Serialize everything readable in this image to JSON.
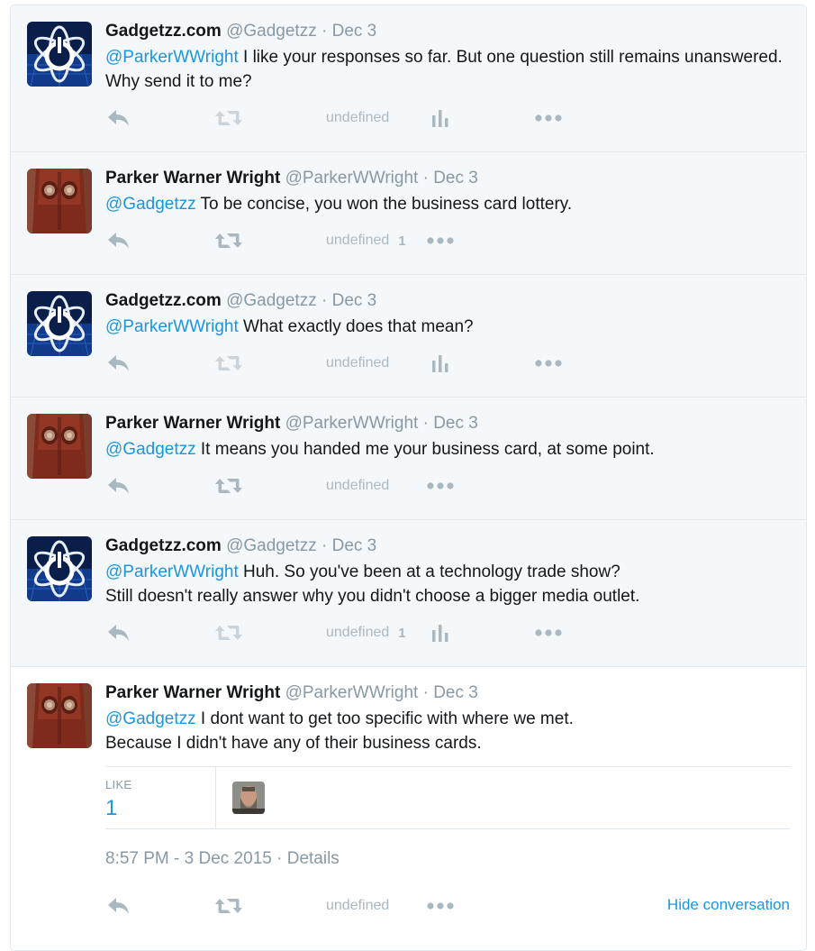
{
  "tweets": [
    {
      "fullname": "Gadgetzz.com",
      "username": "@Gadgetzz",
      "sep": "·",
      "time": "Dec 3",
      "lines": [
        [
          {
            "m": "@ParkerWWright"
          },
          {
            "t": " I like your responses so far. But one question still remains unanswered. Why send it to me?"
          }
        ]
      ],
      "like_count": "",
      "has_analytics": true
    },
    {
      "fullname": "Parker Warner Wright",
      "username": "@ParkerWWright",
      "sep": "·",
      "time": "Dec 3",
      "lines": [
        [
          {
            "m": "@Gadgetzz"
          },
          {
            "t": " To be concise, you won the business card lottery."
          }
        ]
      ],
      "like_count": "1",
      "has_analytics": false
    },
    {
      "fullname": "Gadgetzz.com",
      "username": "@Gadgetzz",
      "sep": "·",
      "time": "Dec 3",
      "lines": [
        [
          {
            "m": "@ParkerWWright"
          },
          {
            "t": " What exactly does that mean?"
          }
        ]
      ],
      "like_count": "",
      "has_analytics": true
    },
    {
      "fullname": "Parker Warner Wright",
      "username": "@ParkerWWright",
      "sep": "·",
      "time": "Dec 3",
      "lines": [
        [
          {
            "m": "@Gadgetzz"
          },
          {
            "t": " It means you handed me your business card, at some point."
          }
        ]
      ],
      "like_count": "",
      "has_analytics": false
    },
    {
      "fullname": "Gadgetzz.com",
      "username": "@Gadgetzz",
      "sep": "·",
      "time": "Dec 3",
      "lines": [
        [
          {
            "m": "@ParkerWWright"
          },
          {
            "t": " Huh. So you've been at a technology trade show?"
          }
        ],
        [
          {
            "t": "Still doesn't really answer why you didn't choose a bigger media outlet."
          }
        ]
      ],
      "like_count": "1",
      "has_analytics": true
    },
    {
      "fullname": "Parker Warner Wright",
      "username": "@ParkerWWright",
      "sep": "·",
      "time": "Dec 3",
      "lines": [
        [
          {
            "m": "@Gadgetzz"
          },
          {
            "t": " I dont want to get too specific with where we met."
          }
        ],
        [
          {
            "t": "Because I didn't have any of their business cards."
          }
        ]
      ],
      "like_count": "",
      "has_analytics": false
    }
  ],
  "focused": {
    "like_label": "LIKE",
    "like_count": "1",
    "timestamp": "8:57 PM - 3 Dec 2015",
    "sep": "·",
    "details": "Details",
    "hide_conversation": "Hide conversation"
  },
  "icons": {
    "reply": "reply-icon",
    "retweet": "retweet-icon",
    "like": "heart-icon",
    "analytics": "analytics-icon",
    "more": "more-icon"
  },
  "colors": {
    "link": "#1b95e0",
    "muted": "#8899a6",
    "icon": "#aab8c2",
    "bg_thread": "#f5f8fa",
    "border": "#e1e8ed"
  }
}
